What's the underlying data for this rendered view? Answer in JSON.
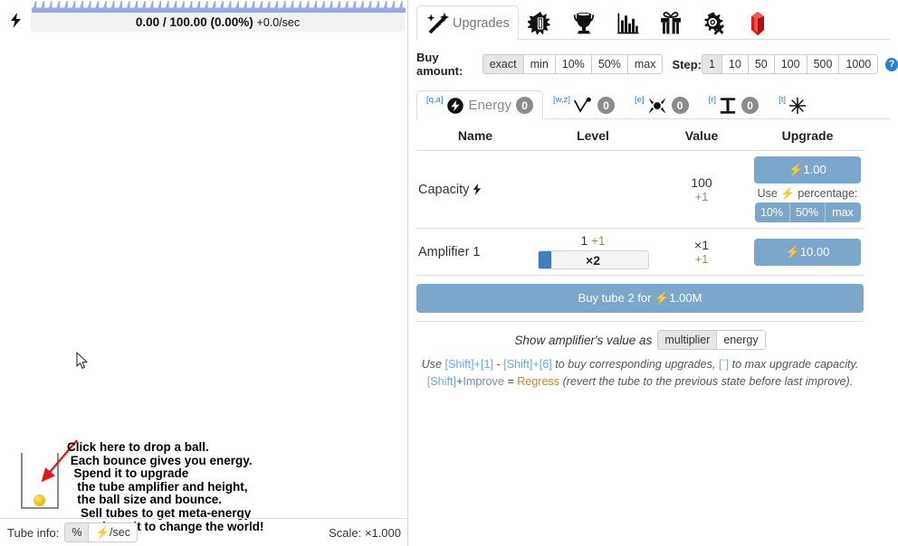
{
  "left": {
    "energy": {
      "bolt_icon": "lightning-bolt-icon",
      "current": "0.00",
      "separator": " / ",
      "max": "100.00",
      "percent": "(0.00%)",
      "rate": "+0.0/sec",
      "full_text": "0.00 / 100.00 (0.00%) +0.0/sec"
    },
    "tutorial_text": "Click here to drop a ball.\n Each bounce gives you energy.\n  Spend it to upgrade\n   the tube amplifier and height,\n   the ball size and bounce.\n    Sell tubes to get meta-energy\n     and use it to change the world!",
    "tube_info": {
      "label": "Tube info:",
      "buttons": [
        {
          "label": "%",
          "active": true
        },
        {
          "label": "⚡/sec",
          "active": false
        }
      ]
    },
    "scale": "Scale: ×1.000"
  },
  "main_tabs": [
    {
      "label": "Upgrades",
      "icon": "sparkle-wand-icon",
      "active": true
    },
    {
      "label": "",
      "icon": "broken-tube-icon",
      "active": false
    },
    {
      "label": "",
      "icon": "trophy-icon",
      "active": false
    },
    {
      "label": "",
      "icon": "bar-chart-icon",
      "active": false
    },
    {
      "label": "",
      "icon": "gift-icon",
      "active": false
    },
    {
      "label": "",
      "icon": "gear-wrench-icon",
      "active": false
    },
    {
      "label": "",
      "icon": "red-gem-icon",
      "active": false
    }
  ],
  "buy_amount": {
    "label": "Buy amount:",
    "options": [
      {
        "label": "exact",
        "active": true
      },
      {
        "label": "min",
        "active": false
      },
      {
        "label": "10%",
        "active": false
      },
      {
        "label": "50%",
        "active": false
      },
      {
        "label": "max",
        "active": false
      }
    ],
    "step_label": "Step:",
    "step_options": [
      {
        "label": "1",
        "active": true
      },
      {
        "label": "10",
        "active": false
      },
      {
        "label": "50",
        "active": false
      },
      {
        "label": "100",
        "active": false
      },
      {
        "label": "500",
        "active": false
      },
      {
        "label": "1000",
        "active": false
      }
    ],
    "help_icon": "?"
  },
  "sub_tabs": [
    {
      "key": "[q,a]",
      "icon": "energy-circle-icon",
      "label": "Energy",
      "badge": "0",
      "active": true
    },
    {
      "key": "[w,z]",
      "icon": "bounce-icon",
      "label": "",
      "badge": "0",
      "active": false
    },
    {
      "key": "[e]",
      "icon": "ball-size-icon",
      "label": "",
      "badge": "0",
      "active": false
    },
    {
      "key": "[r]",
      "icon": "tube-height-icon",
      "label": "",
      "badge": "0",
      "active": false
    },
    {
      "key": "[t]",
      "icon": "asterisk-star-icon",
      "label": "",
      "badge": "",
      "active": false
    }
  ],
  "table": {
    "headers": [
      "Name",
      "Level",
      "Value",
      "Upgrade"
    ],
    "rows": [
      {
        "name": "Capacity",
        "name_icon": "lightning-bolt-icon",
        "level_text": "",
        "level_bar_text": "",
        "level_fill_pct": 0,
        "value_main": "100",
        "value_delta": "+1",
        "upgrade_label": "⚡1.00",
        "use_pct_label": "Use ⚡ percentage:",
        "pct_buttons": [
          "10%",
          "50%",
          "max"
        ]
      },
      {
        "name": "Amplifier 1",
        "name_icon": "",
        "level_text": "1 +1",
        "level_main": "1",
        "level_plus": "+1",
        "level_bar_text": "×2",
        "level_fill_pct": 12,
        "value_main": "×1",
        "value_delta": "+1",
        "upgrade_label": "⚡10.00",
        "use_pct_label": "",
        "pct_buttons": []
      }
    ]
  },
  "buy_tube": {
    "label": "Buy tube 2 for ⚡1.00M"
  },
  "hints": {
    "show_as_label": "Show amplifier's value as",
    "show_as_options": [
      {
        "label": "multiplier",
        "active": true
      },
      {
        "label": "energy",
        "active": false
      }
    ],
    "line1": {
      "part1": "Use ",
      "kb1": "[Shift]+[1]",
      "part2": " - ",
      "kb2": "[Shift]+[6]",
      "part3": " to buy corresponding upgrades, ",
      "kb3": "[`]",
      "part4": " to max upgrade capacity."
    },
    "line2": {
      "kb1": "[Shift]",
      "part1": "+",
      "improve": "Improve",
      "part2": " = ",
      "regress": "Regress",
      "part3": " (revert the tube to the previous state before last improve)."
    }
  },
  "colors": {
    "accent_blue": "#7ba7cb",
    "progress_blue": "#3f7fbf",
    "key_blue": "#6fa8dc",
    "regress_orange": "#c8862e",
    "delta_tan": "#9e8b52",
    "sawtooth_blue": "#96aaea",
    "ball_gold": "#f5c218",
    "gem_red": "#e01b1b"
  }
}
